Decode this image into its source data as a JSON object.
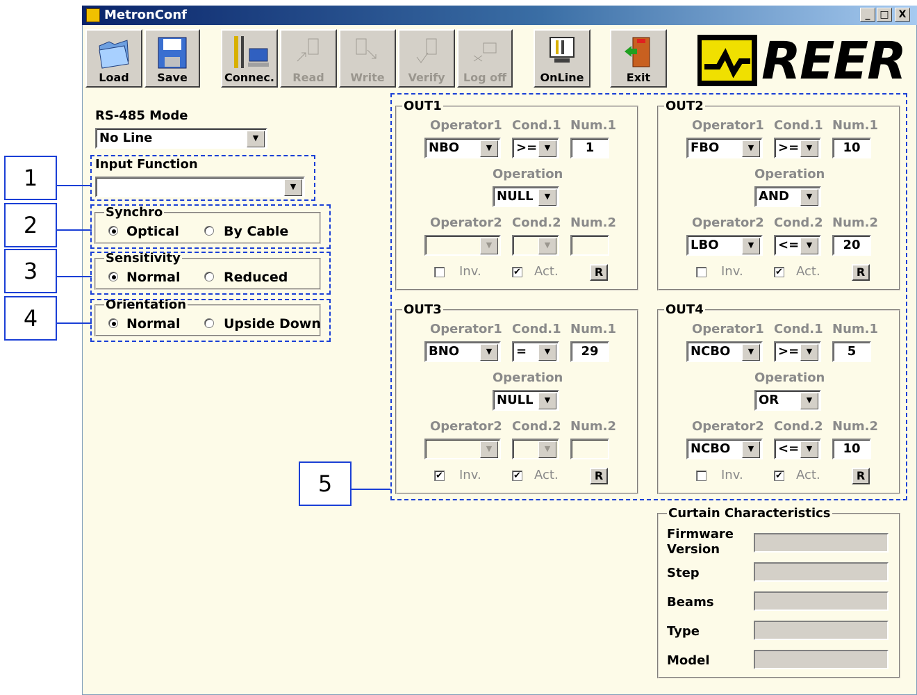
{
  "window": {
    "title": "MetronConf",
    "min": "_",
    "max": "□",
    "close": "X"
  },
  "toolbar": {
    "load": "Load",
    "save": "Save",
    "connect": "Connec.",
    "read": "Read",
    "write": "Write",
    "verify": "Verify",
    "logoff": "Log off",
    "online": "OnLine",
    "exit": "Exit"
  },
  "logo": {
    "text": "REER",
    "brand_color": "#000000",
    "accent": "#f0e000"
  },
  "left": {
    "rs485_label": "RS-485 Mode",
    "rs485_value": "No Line",
    "input_function_label": "Input Function",
    "input_function_value": "",
    "synchro": {
      "legend": "Synchro",
      "opt1": "Optical",
      "opt2": "By Cable",
      "selected": "Optical"
    },
    "sensitivity": {
      "legend": "Sensitivity",
      "opt1": "Normal",
      "opt2": "Reduced",
      "selected": "Normal"
    },
    "orientation": {
      "legend": "Orientation",
      "opt1": "Normal",
      "opt2": "Upside Down",
      "selected": "Normal"
    }
  },
  "callouts": [
    "1",
    "2",
    "3",
    "4",
    "5"
  ],
  "labels": {
    "operator1": "Operator1",
    "cond1": "Cond.1",
    "num1": "Num.1",
    "operation": "Operation",
    "operator2": "Operator2",
    "cond2": "Cond.2",
    "num2": "Num.2",
    "inv": "Inv.",
    "act": "Act.",
    "r": "R"
  },
  "outs": [
    {
      "name": "OUT1",
      "op1": "NBO",
      "cond1": ">=",
      "num1": "1",
      "operation": "NULL",
      "op2": "",
      "cond2": "",
      "num2": "",
      "inv": false,
      "act": true
    },
    {
      "name": "OUT2",
      "op1": "FBO",
      "cond1": ">=",
      "num1": "10",
      "operation": "AND",
      "op2": "LBO",
      "cond2": "<=",
      "num2": "20",
      "inv": false,
      "act": true
    },
    {
      "name": "OUT3",
      "op1": "BNO",
      "cond1": "=",
      "num1": "29",
      "operation": "NULL",
      "op2": "",
      "cond2": "",
      "num2": "",
      "inv": true,
      "act": true
    },
    {
      "name": "OUT4",
      "op1": "NCBO",
      "cond1": ">=",
      "num1": "5",
      "operation": "OR",
      "op2": "NCBO",
      "cond2": "<=",
      "num2": "10",
      "inv": false,
      "act": true
    }
  ],
  "curtain": {
    "legend": "Curtain Characteristics",
    "firmware_l1": "Firmware",
    "firmware_l2": "Version",
    "step": "Step",
    "beams": "Beams",
    "type": "Type",
    "model": "Model",
    "firmware_value": "",
    "step_value": "",
    "beams_value": "",
    "type_value": "",
    "model_value": ""
  }
}
